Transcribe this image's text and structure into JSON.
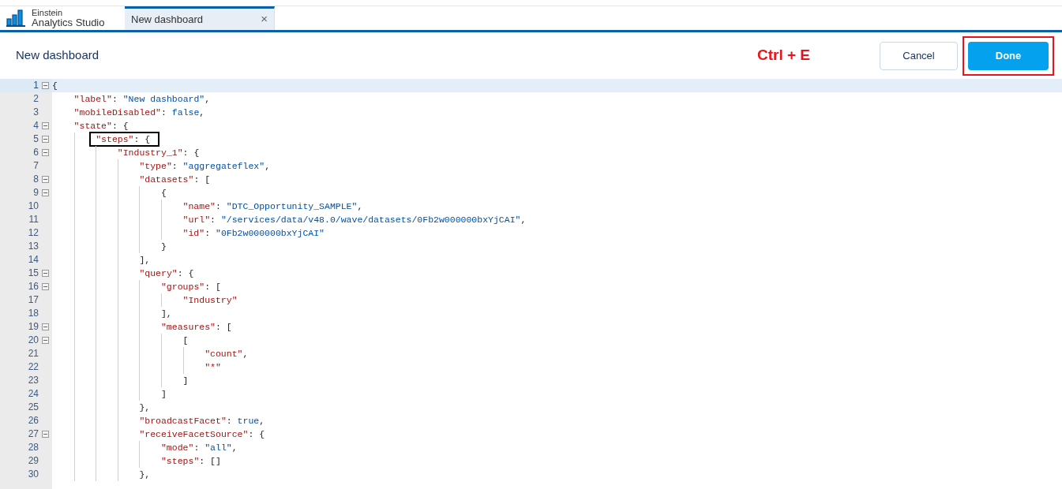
{
  "app": {
    "brand_line1": "Einstein",
    "brand_line2": "Analytics Studio"
  },
  "tabs": [
    {
      "label": "New dashboard",
      "selected": true,
      "close": "×"
    }
  ],
  "header": {
    "title": "New dashboard",
    "shortcut_note": "Ctrl + E",
    "cancel": "Cancel",
    "done": "Done",
    "done_outlined": true
  },
  "editor": {
    "lines": [
      {
        "number": "1",
        "current": true,
        "boxed": false,
        "tokens": [
          {
            "kind": "punct",
            "text": "{"
          }
        ],
        "children": [
          {
            "number": "2",
            "current": false,
            "boxed": false,
            "tokens": [
              {
                "kind": "key",
                "text": "\"label\""
              },
              {
                "kind": "punct",
                "text": ": "
              },
              {
                "kind": "value",
                "text": "\"New dashboard\""
              },
              {
                "kind": "punct",
                "text": ","
              }
            ]
          },
          {
            "number": "3",
            "current": false,
            "boxed": false,
            "tokens": [
              {
                "kind": "key",
                "text": "\"mobileDisabled\""
              },
              {
                "kind": "punct",
                "text": ": "
              },
              {
                "kind": "value",
                "text": "false"
              },
              {
                "kind": "punct",
                "text": ","
              }
            ]
          },
          {
            "number": "4",
            "current": false,
            "boxed": false,
            "tokens": [
              {
                "kind": "key",
                "text": "\"state\""
              },
              {
                "kind": "punct",
                "text": ": {"
              }
            ],
            "children": [
              {
                "number": "5",
                "current": false,
                "boxed": true,
                "tokens": [
                  {
                    "kind": "key",
                    "text": "\"steps\""
                  },
                  {
                    "kind": "punct",
                    "text": ": {"
                  }
                ],
                "children": [
                  {
                    "number": "6",
                    "current": false,
                    "boxed": false,
                    "tokens": [
                      {
                        "kind": "key",
                        "text": "\"Industry_1\""
                      },
                      {
                        "kind": "punct",
                        "text": ": {"
                      }
                    ],
                    "children": [
                      {
                        "number": "7",
                        "current": false,
                        "boxed": false,
                        "tokens": [
                          {
                            "kind": "key",
                            "text": "\"type\""
                          },
                          {
                            "kind": "punct",
                            "text": ": "
                          },
                          {
                            "kind": "value",
                            "text": "\"aggregateflex\""
                          },
                          {
                            "kind": "punct",
                            "text": ","
                          }
                        ]
                      },
                      {
                        "number": "8",
                        "current": false,
                        "boxed": false,
                        "tokens": [
                          {
                            "kind": "key",
                            "text": "\"datasets\""
                          },
                          {
                            "kind": "punct",
                            "text": ": ["
                          }
                        ],
                        "children": [
                          {
                            "number": "9",
                            "current": false,
                            "boxed": false,
                            "tokens": [
                              {
                                "kind": "punct",
                                "text": "{"
                              }
                            ],
                            "children": [
                              {
                                "number": "10",
                                "current": false,
                                "boxed": false,
                                "tokens": [
                                  {
                                    "kind": "key",
                                    "text": "\"name\""
                                  },
                                  {
                                    "kind": "punct",
                                    "text": ": "
                                  },
                                  {
                                    "kind": "value",
                                    "text": "\"DTC_Opportunity_SAMPLE\""
                                  },
                                  {
                                    "kind": "punct",
                                    "text": ","
                                  }
                                ]
                              },
                              {
                                "number": "11",
                                "current": false,
                                "boxed": false,
                                "tokens": [
                                  {
                                    "kind": "key",
                                    "text": "\"url\""
                                  },
                                  {
                                    "kind": "punct",
                                    "text": ": "
                                  },
                                  {
                                    "kind": "value",
                                    "text": "\"/services/data/v48.0/wave/datasets/0Fb2w000000bxYjCAI\""
                                  },
                                  {
                                    "kind": "punct",
                                    "text": ","
                                  }
                                ]
                              },
                              {
                                "number": "12",
                                "current": false,
                                "boxed": false,
                                "tokens": [
                                  {
                                    "kind": "key",
                                    "text": "\"id\""
                                  },
                                  {
                                    "kind": "punct",
                                    "text": ": "
                                  },
                                  {
                                    "kind": "value",
                                    "text": "\"0Fb2w000000bxYjCAI\""
                                  }
                                ]
                              }
                            ]
                          },
                          {
                            "number": "13",
                            "current": false,
                            "boxed": false,
                            "tokens": [
                              {
                                "kind": "punct",
                                "text": "}"
                              }
                            ]
                          }
                        ]
                      },
                      {
                        "number": "14",
                        "current": false,
                        "boxed": false,
                        "tokens": [
                          {
                            "kind": "punct",
                            "text": "],"
                          }
                        ]
                      },
                      {
                        "number": "15",
                        "current": false,
                        "boxed": false,
                        "tokens": [
                          {
                            "kind": "key",
                            "text": "\"query\""
                          },
                          {
                            "kind": "punct",
                            "text": ": {"
                          }
                        ],
                        "children": [
                          {
                            "number": "16",
                            "current": false,
                            "boxed": false,
                            "tokens": [
                              {
                                "kind": "key",
                                "text": "\"groups\""
                              },
                              {
                                "kind": "punct",
                                "text": ": ["
                              }
                            ],
                            "children": [
                              {
                                "number": "17",
                                "current": false,
                                "boxed": false,
                                "tokens": [
                                  {
                                    "kind": "key",
                                    "text": "\"Industry\""
                                  }
                                ]
                              }
                            ]
                          },
                          {
                            "number": "18",
                            "current": false,
                            "boxed": false,
                            "tokens": [
                              {
                                "kind": "punct",
                                "text": "],"
                              }
                            ]
                          },
                          {
                            "number": "19",
                            "current": false,
                            "boxed": false,
                            "tokens": [
                              {
                                "kind": "key",
                                "text": "\"measures\""
                              },
                              {
                                "kind": "punct",
                                "text": ": ["
                              }
                            ],
                            "children": [
                              {
                                "number": "20",
                                "current": false,
                                "boxed": false,
                                "tokens": [
                                  {
                                    "kind": "punct",
                                    "text": "["
                                  }
                                ],
                                "children": [
                                  {
                                    "number": "21",
                                    "current": false,
                                    "boxed": false,
                                    "tokens": [
                                      {
                                        "kind": "key",
                                        "text": "\"count\""
                                      },
                                      {
                                        "kind": "punct",
                                        "text": ","
                                      }
                                    ]
                                  },
                                  {
                                    "number": "22",
                                    "current": false,
                                    "boxed": false,
                                    "tokens": [
                                      {
                                        "kind": "key",
                                        "text": "\"*\""
                                      }
                                    ]
                                  }
                                ]
                              },
                              {
                                "number": "23",
                                "current": false,
                                "boxed": false,
                                "tokens": [
                                  {
                                    "kind": "punct",
                                    "text": "]"
                                  }
                                ]
                              }
                            ]
                          },
                          {
                            "number": "24",
                            "current": false,
                            "boxed": false,
                            "tokens": [
                              {
                                "kind": "punct",
                                "text": "]"
                              }
                            ]
                          }
                        ]
                      },
                      {
                        "number": "25",
                        "current": false,
                        "boxed": false,
                        "tokens": [
                          {
                            "kind": "punct",
                            "text": "},"
                          }
                        ]
                      },
                      {
                        "number": "26",
                        "current": false,
                        "boxed": false,
                        "tokens": [
                          {
                            "kind": "key",
                            "text": "\"broadcastFacet\""
                          },
                          {
                            "kind": "punct",
                            "text": ": "
                          },
                          {
                            "kind": "value",
                            "text": "true"
                          },
                          {
                            "kind": "punct",
                            "text": ","
                          }
                        ]
                      },
                      {
                        "number": "27",
                        "current": false,
                        "boxed": false,
                        "tokens": [
                          {
                            "kind": "key",
                            "text": "\"receiveFacetSource\""
                          },
                          {
                            "kind": "punct",
                            "text": ": {"
                          }
                        ],
                        "children": [
                          {
                            "number": "28",
                            "current": false,
                            "boxed": false,
                            "tokens": [
                              {
                                "kind": "key",
                                "text": "\"mode\""
                              },
                              {
                                "kind": "punct",
                                "text": ": "
                              },
                              {
                                "kind": "value",
                                "text": "\"all\""
                              },
                              {
                                "kind": "punct",
                                "text": ","
                              }
                            ]
                          },
                          {
                            "number": "29",
                            "current": false,
                            "boxed": false,
                            "tokens": [
                              {
                                "kind": "key",
                                "text": "\"steps\""
                              },
                              {
                                "kind": "punct",
                                "text": ": []"
                              }
                            ]
                          }
                        ]
                      },
                      {
                        "number": "30",
                        "current": false,
                        "boxed": false,
                        "tokens": [
                          {
                            "kind": "punct",
                            "text": "},"
                          }
                        ]
                      }
                    ]
                  }
                ]
              }
            ]
          }
        ]
      }
    ]
  }
}
